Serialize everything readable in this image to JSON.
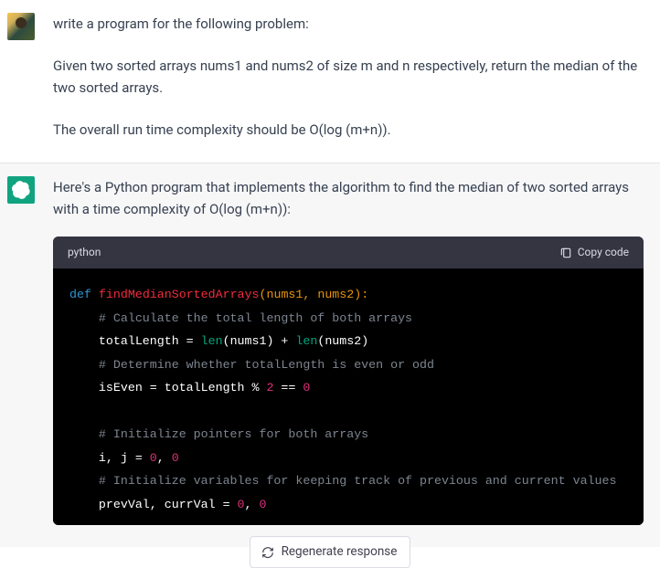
{
  "user": {
    "p1": "write a program for the following problem:",
    "p2": "Given two sorted arrays nums1 and nums2 of size m and n respectively, return the median of the two sorted arrays.",
    "p3": "The overall run time complexity should be O(log (m+n))."
  },
  "assistant": {
    "intro": "Here's a Python program that implements the algorithm to find the median of two sorted arrays with a time complexity of O(log (m+n)):",
    "code_lang": "python",
    "copy_label": "Copy code",
    "code": {
      "kw_def": "def",
      "fn_name": "findMedianSortedArrays",
      "sig_open": "(nums1, nums2):",
      "c1": "# Calculate the total length of both arrays",
      "l2_lhs": "totalLength = ",
      "l2_len1": "len",
      "l2_arg1": "(nums1) + ",
      "l2_len2": "len",
      "l2_arg2": "(nums2)",
      "c2": "# Determine whether totalLength is even or odd",
      "l3_a": "isEven = totalLength % ",
      "l3_two": "2",
      "l3_b": " == ",
      "l3_zero": "0",
      "c3": "# Initialize pointers for both arrays",
      "l4_a": "i, j = ",
      "l4_v1": "0",
      "l4_c": ", ",
      "l4_v2": "0",
      "c4": "# Initialize variables for keeping track of previous and current values",
      "l5_a": "prevVal, currVal = ",
      "l5_v1": "0",
      "l5_c": ", ",
      "l5_v2": "0"
    }
  },
  "regen_label": "Regenerate response"
}
